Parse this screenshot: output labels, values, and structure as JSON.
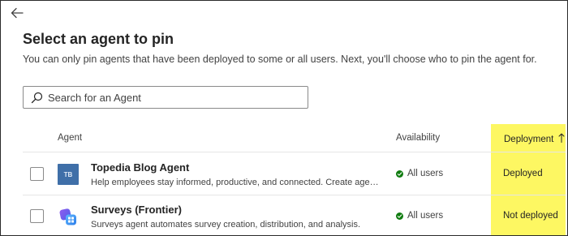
{
  "header": {
    "title": "Select an agent to pin",
    "subtitle": "You can only pin agents that have been deployed to some or all users. Next, you'll choose who to pin the agent for."
  },
  "search": {
    "placeholder": "Search for an Agent",
    "value": ""
  },
  "table": {
    "columns": {
      "agent": "Agent",
      "availability": "Availability",
      "deployment": "Deployment",
      "deployment_sort": "ascending"
    },
    "rows": [
      {
        "icon_text": "TB",
        "icon_name": "topedia-blog-agent-icon",
        "name": "Topedia Blog Agent",
        "description": "Help employees stay informed, productive, and connected. Create agents and a...",
        "availability": "All users",
        "deployment": "Deployed",
        "checked": false
      },
      {
        "icon_text": "",
        "icon_name": "surveys-agent-icon",
        "name": "Surveys (Frontier)",
        "description": "Surveys agent automates survey creation, distribution, and analysis.",
        "availability": "All users",
        "deployment": "Not deployed",
        "checked": false
      }
    ]
  },
  "colors": {
    "highlight": "#fdf762",
    "status_ok": "#107c10",
    "tb_icon_bg": "#3f6fa8"
  }
}
